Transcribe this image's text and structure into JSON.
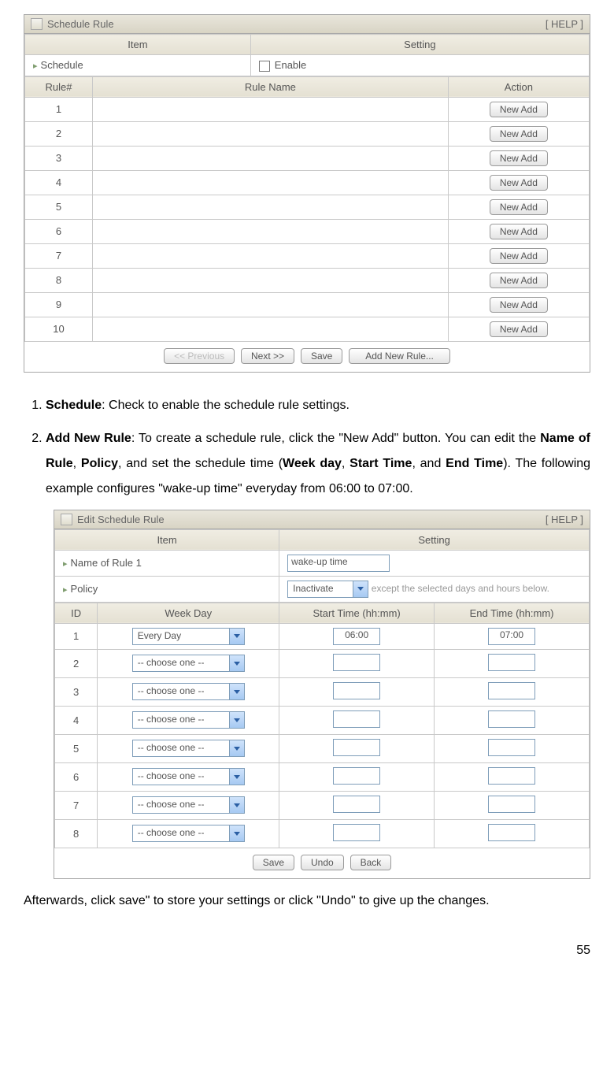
{
  "panel1": {
    "title": "Schedule Rule",
    "help": "[ HELP ]",
    "headers": {
      "item": "Item",
      "setting": "Setting",
      "rule": "Rule#",
      "rulename": "Rule Name",
      "action": "Action"
    },
    "schedule_label": "Schedule",
    "enable_label": "Enable",
    "rows": [
      "1",
      "2",
      "3",
      "4",
      "5",
      "6",
      "7",
      "8",
      "9",
      "10"
    ],
    "new_add": "New Add",
    "footer": {
      "prev": "<< Previous",
      "next": "Next >>",
      "save": "Save",
      "addnew": "Add New Rule..."
    }
  },
  "body": {
    "item1_bold": "Schedule",
    "item1_rest": ": Check to enable the schedule rule settings.",
    "item2_bold": "Add New Rule",
    "item2_a": ": To create a schedule rule, click the \"New Add\" button. You can edit the ",
    "item2_b1": "Name of Rule",
    "item2_b2": ", ",
    "item2_b3": "Policy",
    "item2_b4": ", and set the schedule time (",
    "item2_b5": "Week day",
    "item2_b6": ", ",
    "item2_b7": "Start Time",
    "item2_b8": ", and ",
    "item2_b9": "End Time",
    "item2_b10": "). The following example configures \"wake-up time\" everyday from 06:00 to 07:00."
  },
  "panel2": {
    "title": "Edit Schedule Rule",
    "help": "[ HELP ]",
    "headers": {
      "item": "Item",
      "setting": "Setting",
      "id": "ID",
      "weekday": "Week Day",
      "start": "Start Time (hh:mm)",
      "end": "End Time (hh:mm)"
    },
    "name_label": "Name of Rule 1",
    "name_value": "wake-up time",
    "policy_label": "Policy",
    "policy_value": "Inactivate",
    "policy_note": "except the selected days and hours below.",
    "rows": [
      {
        "id": "1",
        "day": "Every Day",
        "start": "06:00",
        "end": "07:00"
      },
      {
        "id": "2",
        "day": "-- choose one --",
        "start": "",
        "end": ""
      },
      {
        "id": "3",
        "day": "-- choose one --",
        "start": "",
        "end": ""
      },
      {
        "id": "4",
        "day": "-- choose one --",
        "start": "",
        "end": ""
      },
      {
        "id": "5",
        "day": "-- choose one --",
        "start": "",
        "end": ""
      },
      {
        "id": "6",
        "day": "-- choose one --",
        "start": "",
        "end": ""
      },
      {
        "id": "7",
        "day": "-- choose one --",
        "start": "",
        "end": ""
      },
      {
        "id": "8",
        "day": "-- choose one --",
        "start": "",
        "end": ""
      }
    ],
    "footer": {
      "save": "Save",
      "undo": "Undo",
      "back": "Back"
    }
  },
  "after": "Afterwards, click save\" to store your settings or click \"Undo\" to give up the changes.",
  "page": "55"
}
